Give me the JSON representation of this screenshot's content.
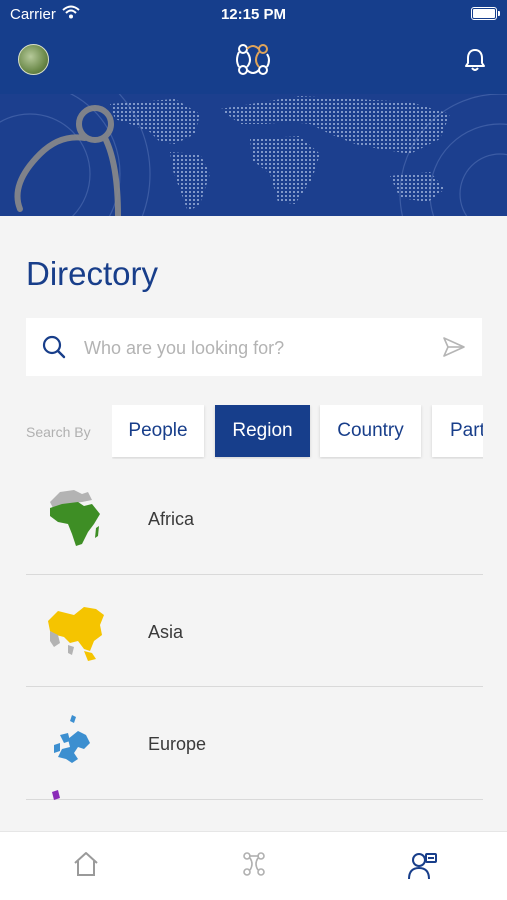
{
  "status_bar": {
    "carrier": "Carrier",
    "time": "12:15 PM"
  },
  "header": {
    "avatar_icon": "user-avatar",
    "logo_icon": "app-logo-icon",
    "bell_icon": "bell-icon"
  },
  "page": {
    "title": "Directory"
  },
  "search": {
    "placeholder": "Who are you looking for?"
  },
  "search_by": {
    "label": "Search By",
    "options": [
      "People",
      "Region",
      "Country",
      "Part"
    ],
    "selected": "Region"
  },
  "regions": [
    {
      "label": "Africa",
      "color": "#3e8e25"
    },
    {
      "label": "Asia",
      "color": "#f5c400"
    },
    {
      "label": "Europe",
      "color": "#3c8fd0"
    }
  ],
  "tabbar": {
    "items": [
      "home-icon",
      "network-icon",
      "directory-icon"
    ],
    "active": "directory-icon"
  },
  "colors": {
    "brand": "#163e8c",
    "accent_logo": "#e0a45a"
  }
}
